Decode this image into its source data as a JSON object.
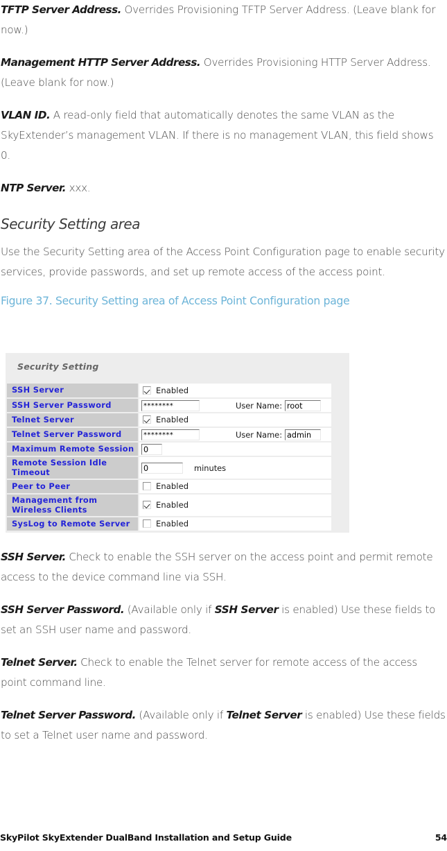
{
  "document": {
    "footer_title": "SkyPilot SkyExtender DualBand Installation and Setup Guide",
    "page_number": "54"
  },
  "top_paragraphs": [
    {
      "lead": "TFTP Server Address.",
      "text": " Overrides Provisioning TFTP Server Address. (Leave blank for now.)"
    },
    {
      "lead": "Management HTTP Server Address.",
      "text": " Overrides Provisioning HTTP Server Address. (Leave blank for now.)"
    },
    {
      "lead": "VLAN ID.",
      "text": " A read-only field that automatically denotes the same VLAN as the SkyExtender’s management VLAN. If there is no management VLAN, this field shows 0."
    },
    {
      "lead": "NTP Server.",
      "text": " xxx."
    }
  ],
  "section": {
    "heading": "Security Setting area",
    "intro": "Use the Security Setting area of the Access Point Configuration page to enable security services, provide passwords, and set up remote access of the access point.",
    "figure_caption": "Figure 37. Security Setting area of Access Point Configuration page"
  },
  "figure": {
    "title": "Security Setting",
    "enabled_label": "Enabled",
    "username_label": "User Name:",
    "minutes_label": "minutes",
    "rows": [
      {
        "label": "SSH Server",
        "control": "checkbox",
        "checked": true
      },
      {
        "label": "SSH Server Password",
        "control": "password-user",
        "password": "********",
        "username": "root"
      },
      {
        "label": "Telnet Server",
        "control": "checkbox",
        "checked": true
      },
      {
        "label": "Telnet Server Password",
        "control": "password-user",
        "password": "********",
        "username": "admin"
      },
      {
        "label": "Maximum Remote Session",
        "control": "number-small",
        "value": "0"
      },
      {
        "label": "Remote Session Idle Timeout",
        "control": "number-medium",
        "value": "0",
        "unit": "minutes"
      },
      {
        "label": "Peer to Peer",
        "control": "checkbox",
        "checked": false
      },
      {
        "label": "Management from Wireless Clients",
        "control": "checkbox",
        "checked": true
      },
      {
        "label": "SysLog to Remote Server",
        "control": "checkbox",
        "checked": false
      }
    ]
  },
  "bottom_paragraphs": [
    {
      "lead": "SSH Server.",
      "text": " Check to enable the SSH server on the access point and permit remote access to the device command line via SSH."
    },
    {
      "lead": "SSH Server Password.",
      "pre": "  (Available only if ",
      "inline": "SSH Server",
      "post": " is enabled) Use these fields to set an SSH user name and password."
    },
    {
      "lead": "Telnet Server.",
      "text": " Check to enable the Telnet server for remote access of the access point command line."
    },
    {
      "lead": "Telnet Server Password.",
      "pre": "  (Available only if ",
      "inline": "Telnet Server",
      "post": " is enabled) Use these fields to set a Telnet user name and password."
    }
  ],
  "colors": {
    "caption_blue": "#6cb4d8",
    "label_blue": "#2323d8",
    "label_bg": "#cccccc",
    "figure_bg": "#ededed"
  }
}
